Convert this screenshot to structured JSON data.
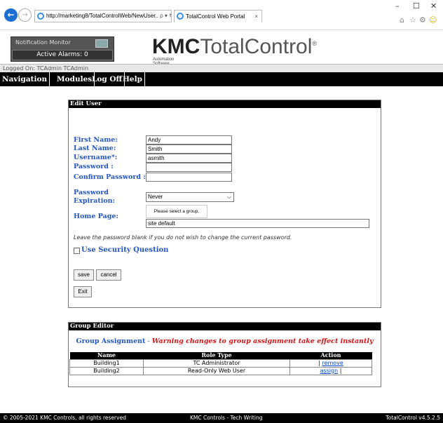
{
  "browser": {
    "url": "http://marketing8/TotalControlWeb/NewUser..",
    "search_hint": "ρ ▾ ↻",
    "tab_title": "TotalControl Web Portal",
    "tab_close": "×",
    "min": "–",
    "max": "☐",
    "close": "✕"
  },
  "header": {
    "notification_title": "Notification Monitor",
    "active_alarms": "Active Alarms: 0",
    "brand_bold": "KMC",
    "brand_light": "TotalControl",
    "brand_reg": "®",
    "brand_sub": "Automation Software"
  },
  "logged_on": "Logged On: TCAdmin TCAdmin",
  "menu": {
    "navigation": "Navigation",
    "modules": "Modules",
    "logoff": "Log Off",
    "help": "Help"
  },
  "edit_user": {
    "title": "Edit User",
    "first_name_label": "First Name:",
    "first_name": "Andy",
    "last_name_label": "Last Name:",
    "last_name": "Smith",
    "username_label": "Username*:",
    "username": "asmith",
    "password_label": "Password :",
    "password": "",
    "confirm_label": "Confirm Password :",
    "confirm": "",
    "expiration_label_1": "Password",
    "expiration_label_2": "Expiration:",
    "expiration_value": "Never",
    "home_page_label": "Home Page:",
    "group_button": "Please select a group.",
    "home_page_value": "site default",
    "hint": "Leave the password blank if you do not wish to change the current password.",
    "security_question": "Use Security Question",
    "save": "save",
    "cancel": "cancel",
    "exit": "Exit"
  },
  "group_editor": {
    "title": "Group Editor",
    "assignment": "Group Assignment",
    "dash": " - ",
    "warning": "Warning changes to group assignment take effect instantly",
    "columns": [
      "Name",
      "Role Type",
      "Action"
    ],
    "rows": [
      {
        "name": "Building1",
        "role": "TC Administrator",
        "pre": "| ",
        "action": "remove",
        "post": ""
      },
      {
        "name": "Building2",
        "role": "Read-Only Web User",
        "pre": "",
        "action": "assign",
        "post": " |"
      }
    ]
  },
  "footer": {
    "copyright": "© 2005-2021 KMC Controls, all rights reserved",
    "site": "KMC Controls - Tech Writing",
    "version": "TotalControl v4.5.2.5"
  },
  "colors": {
    "label_blue": "#2255cc",
    "warning_red": "#dd1111",
    "header_black": "#000000"
  }
}
